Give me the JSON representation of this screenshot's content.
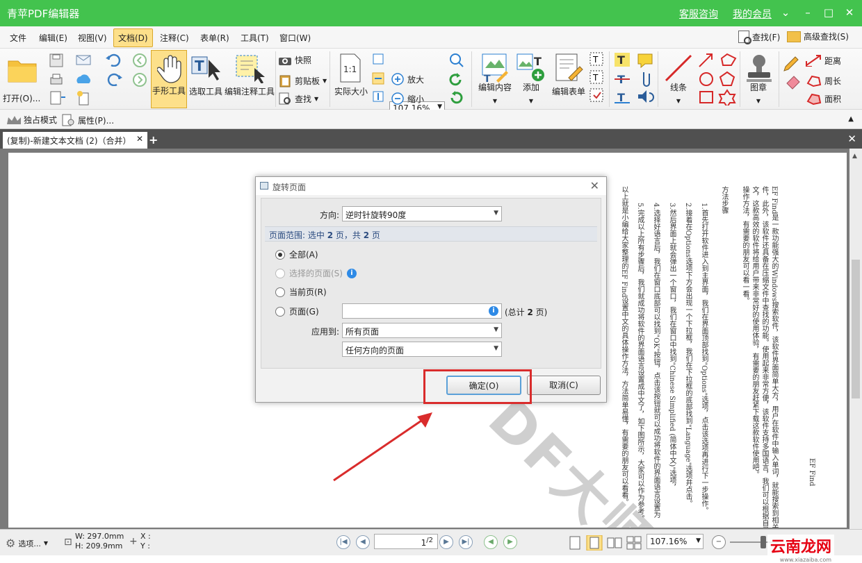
{
  "window": {
    "title": "青苹PDF编辑器",
    "links": [
      "客服咨询",
      "我的会员"
    ]
  },
  "menu": {
    "items": [
      "文件",
      "编辑(E)",
      "视图(V)",
      "文档(D)",
      "注释(C)",
      "表单(R)",
      "工具(T)",
      "窗口(W)"
    ],
    "active": "文档(D)",
    "search": "查找(F)",
    "advanced_search": "高级查找(S)"
  },
  "ribbon": {
    "open": "打开(O)...",
    "hand_tool": "手形工具",
    "select_tool": "选取工具",
    "edit_annot_tool": "编辑注释工具",
    "snapshot": "快照",
    "clipboard": "剪贴板",
    "find": "查找",
    "actual_size": "实际大小",
    "zoom_value": "107.16%",
    "zoom_in": "放大",
    "zoom_out": "缩小",
    "edit_content": "编辑内容",
    "add": "添加",
    "edit_form": "编辑表单",
    "lines": "线条",
    "stamp": "图章",
    "distance": "距离",
    "perimeter": "周长",
    "area": "面积"
  },
  "subbar": {
    "exclusive_mode": "独占模式",
    "properties": "属性(P)..."
  },
  "tabs": {
    "doc_tab": "(复制)-新建文本文档 (2)（合并）"
  },
  "document": {
    "columns": [
      "EF Find是一款功能强大的Windows搜索软件，该软件界面简单大方，用户在软件中输入单词，就能搜索到相关的文件",
      "件，此外，该软件还具备在压缩文件中查找的功能。使用起来非常方便，该软件支持多国语言，我们可以根据自己的需要",
      "文，这款高效的软件将给用户带来非常好的使用体验，有需要的朋友赶紧下载这款软件使用吧。",
      "操作方法，有需要的朋友可以看一看。",
      "方法步骤",
      "1.首先打开软件进入到主界面，我们在界面顶部找到\"Options\"选项，点击该选项再进行下一步操作。",
      "2.接着在Options选项下方会出现一个下拉框，我们在下拉框的底部找到\"Language\"选项并点击。",
      "3.然后界面上就会弹出一个窗口，我们在窗口中找到\"Chinese Simplified (简体中文)\"选项，",
      "4.选择好语言后，我们在窗口底部可以找到\"OK\"按钮，点击该按钮就可以成功将软件的界面语言设置为",
      "5.完成以上所有步骤后，我们就成功将软件的界面语言设置成中文了，如下图所示，大家可以作为参考。",
      "以上就是小编给大家整理的EF Find设置中文的具体操作方法，方法简单易懂，有需要的朋友可以看看。",
      "EF Find"
    ],
    "watermark": "青苹PDF大师"
  },
  "dialog": {
    "title": "旋转页面",
    "direction_label": "方向:",
    "direction_value": "逆时针旋转90度",
    "range_prefix": "页面范围: 选中 ",
    "range_selected": "2",
    "range_mid": " 页，共 ",
    "range_total": "2",
    "range_suffix": " 页",
    "opt_all": "全部(A)",
    "opt_selected": "选择的页面(S)",
    "opt_current": "当前页(R)",
    "opt_pages": "页面(G)",
    "pages_input": "",
    "total_prefix": "(总计 ",
    "total_count": "2",
    "total_suffix": " 页)",
    "apply_label": "应用到:",
    "apply_value1": "所有页面",
    "apply_value2": "任何方向的页面",
    "ok": "确定(O)",
    "cancel": "取消(C)"
  },
  "status": {
    "options": "选项...",
    "width": "W: 297.0mm",
    "height": "H: 209.9mm",
    "x": "X :",
    "y": "Y :",
    "page_current": "1",
    "page_total": "2",
    "zoom": "107.16%"
  },
  "brand": {
    "name": "云南龙网",
    "url": "www.xiazaiba.com"
  },
  "colors": {
    "titlebar": "#43c34e",
    "accent": "#fde08a",
    "highlight": "#d92c2c"
  }
}
